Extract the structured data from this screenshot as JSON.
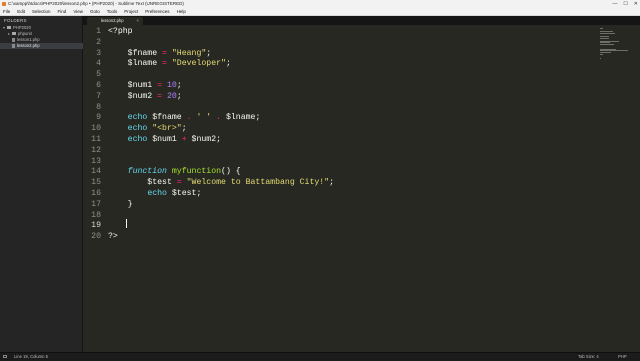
{
  "window": {
    "title": "C:\\xampp\\htdocs\\PHP2020\\lesson2.php • (PHP2020) - Sublime Text (UNREGISTERED)",
    "controls": [
      "—",
      "☐",
      "✕"
    ]
  },
  "menu": [
    "File",
    "Edit",
    "Selection",
    "Find",
    "View",
    "Goto",
    "Tools",
    "Project",
    "Preferences",
    "Help"
  ],
  "sidebar": {
    "header": "FOLDERS",
    "items": [
      {
        "label": "PHP2020",
        "type": "folder",
        "depth": 0,
        "selected": false
      },
      {
        "label": "phpunit",
        "type": "folder",
        "depth": 1,
        "selected": false
      },
      {
        "label": "lesson1.php",
        "type": "file",
        "depth": 1,
        "selected": false
      },
      {
        "label": "lesson2.php",
        "type": "file",
        "depth": 1,
        "selected": true
      }
    ]
  },
  "tabs": [
    {
      "label": "lesson2.php",
      "active": true,
      "close": "×"
    }
  ],
  "editor": {
    "current_line": 19,
    "lines": [
      {
        "n": "1",
        "tokens": [
          {
            "t": "<?php",
            "c": "var"
          }
        ]
      },
      {
        "n": "2",
        "tokens": []
      },
      {
        "n": "3",
        "tokens": [
          {
            "t": "    $fname ",
            "c": "var"
          },
          {
            "t": "=",
            "c": "kw"
          },
          {
            "t": " ",
            "c": "var"
          },
          {
            "t": "\"Heang\"",
            "c": "str"
          },
          {
            "t": ";",
            "c": "var"
          }
        ]
      },
      {
        "n": "4",
        "tokens": [
          {
            "t": "    $lname ",
            "c": "var"
          },
          {
            "t": "=",
            "c": "kw"
          },
          {
            "t": " ",
            "c": "var"
          },
          {
            "t": "\"Developer\"",
            "c": "str"
          },
          {
            "t": ";",
            "c": "var"
          }
        ]
      },
      {
        "n": "5",
        "tokens": []
      },
      {
        "n": "6",
        "tokens": [
          {
            "t": "    $num1 ",
            "c": "var"
          },
          {
            "t": "=",
            "c": "kw"
          },
          {
            "t": " ",
            "c": "var"
          },
          {
            "t": "10",
            "c": "num"
          },
          {
            "t": ";",
            "c": "var"
          }
        ]
      },
      {
        "n": "7",
        "tokens": [
          {
            "t": "    $num2 ",
            "c": "var"
          },
          {
            "t": "=",
            "c": "kw"
          },
          {
            "t": " ",
            "c": "var"
          },
          {
            "t": "20",
            "c": "num"
          },
          {
            "t": ";",
            "c": "var"
          }
        ]
      },
      {
        "n": "8",
        "tokens": []
      },
      {
        "n": "9",
        "tokens": [
          {
            "t": "    ",
            "c": "var"
          },
          {
            "t": "echo",
            "c": "echo"
          },
          {
            "t": " $fname ",
            "c": "var"
          },
          {
            "t": ".",
            "c": "kw"
          },
          {
            "t": " ",
            "c": "var"
          },
          {
            "t": "' '",
            "c": "str"
          },
          {
            "t": " ",
            "c": "var"
          },
          {
            "t": ".",
            "c": "kw"
          },
          {
            "t": " $lname;",
            "c": "var"
          }
        ]
      },
      {
        "n": "10",
        "tokens": [
          {
            "t": "    ",
            "c": "var"
          },
          {
            "t": "echo",
            "c": "echo"
          },
          {
            "t": " ",
            "c": "var"
          },
          {
            "t": "\"<br>\"",
            "c": "str"
          },
          {
            "t": ";",
            "c": "var"
          }
        ]
      },
      {
        "n": "11",
        "tokens": [
          {
            "t": "    ",
            "c": "var"
          },
          {
            "t": "echo",
            "c": "echo"
          },
          {
            "t": " $num1 ",
            "c": "var"
          },
          {
            "t": "+",
            "c": "kw"
          },
          {
            "t": " $num2;",
            "c": "var"
          }
        ]
      },
      {
        "n": "12",
        "tokens": []
      },
      {
        "n": "13",
        "tokens": []
      },
      {
        "n": "14",
        "tokens": [
          {
            "t": "    ",
            "c": "var"
          },
          {
            "t": "function",
            "c": "fnkw"
          },
          {
            "t": " ",
            "c": "var"
          },
          {
            "t": "myfunction",
            "c": "fn"
          },
          {
            "t": "() {",
            "c": "var"
          }
        ]
      },
      {
        "n": "15",
        "tokens": [
          {
            "t": "        $test ",
            "c": "var"
          },
          {
            "t": "=",
            "c": "kw"
          },
          {
            "t": " ",
            "c": "var"
          },
          {
            "t": "\"Welcome to Battambang City!\"",
            "c": "str"
          },
          {
            "t": ";",
            "c": "var"
          }
        ]
      },
      {
        "n": "16",
        "tokens": [
          {
            "t": "        ",
            "c": "var"
          },
          {
            "t": "echo",
            "c": "echo"
          },
          {
            "t": " $test;",
            "c": "var"
          }
        ]
      },
      {
        "n": "17",
        "tokens": [
          {
            "t": "    }",
            "c": "var"
          }
        ]
      },
      {
        "n": "18",
        "tokens": []
      },
      {
        "n": "19",
        "tokens": []
      },
      {
        "n": "20",
        "tokens": [
          {
            "t": "?>",
            "c": "var"
          }
        ]
      }
    ]
  },
  "status": {
    "position": "Line 19, Column 5",
    "tab_size": "Tab Size: 4",
    "syntax": "PHP"
  },
  "colors": {
    "editor_bg": "#272822",
    "sidebar_bg": "#252526",
    "keyword": "#f92672",
    "string": "#e6db74",
    "number": "#ae81ff",
    "function_keyword": "#66d9ef",
    "function_name": "#a6e22e"
  }
}
